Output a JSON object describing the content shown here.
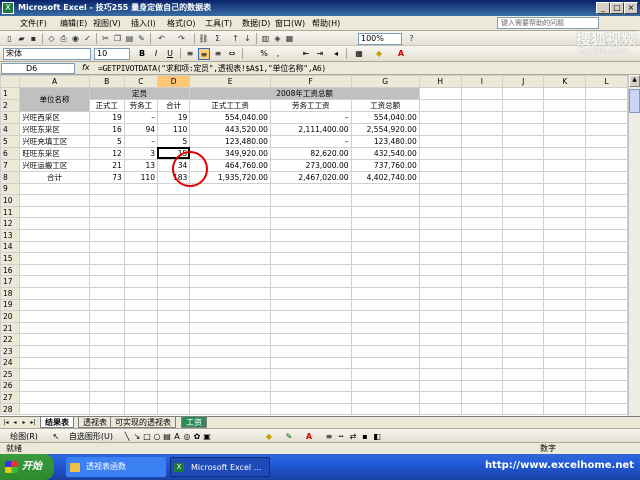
{
  "window": {
    "title": "Microsoft Excel - 技巧255 量身定做自己的数据表"
  },
  "menus": [
    "文件(F)",
    "编辑(E)",
    "视图(V)",
    "插入(I)",
    "格式(O)",
    "工具(T)",
    "数据(D)",
    "窗口(W)",
    "帮助(H)"
  ],
  "help_placeholder": "键入需要帮助的问题",
  "toolbar": {
    "zoom": "100%",
    "font": "宋体",
    "font_size": "10",
    "bold": "B",
    "italic": "I",
    "underline": "U",
    "percent": "%",
    "comma": ","
  },
  "formula_bar": {
    "cell_ref": "D6",
    "fx": "fx",
    "formula": "=GETPIVOTDATA(\"求和项:定员\",透视表!$A$1,\"单位名称\",A6)"
  },
  "watermark": {
    "line1": "搜狐视频",
    "line2": "tv.sohu.com"
  },
  "columns": [
    "A",
    "B",
    "C",
    "D",
    "E",
    "F",
    "G",
    "H",
    "I",
    "J",
    "K",
    "L"
  ],
  "rows": [
    "1",
    "2",
    "3",
    "4",
    "5",
    "6",
    "7",
    "8",
    "9",
    "10",
    "11",
    "12",
    "13",
    "14",
    "15",
    "16",
    "17",
    "18",
    "19",
    "20",
    "21",
    "22",
    "23",
    "24",
    "25",
    "26",
    "27",
    "28"
  ],
  "table": {
    "unit_name_header": "单位名称",
    "quota_header": "定员",
    "salary_header": "2008年工资总额",
    "sub_headers": [
      "正式工",
      "劳务工",
      "合计",
      "正式工工资",
      "劳务工工资",
      "工资总额"
    ],
    "rows": [
      [
        "兴旺西采区",
        "19",
        "–",
        "19",
        "554,040.00",
        "–",
        "554,040.00"
      ],
      [
        "兴旺东采区",
        "16",
        "94",
        "110",
        "443,520.00",
        "2,111,400.00",
        "2,554,920.00"
      ],
      [
        "兴旺充填工区",
        "5",
        "–",
        "5",
        "123,480.00",
        "–",
        "123,480.00"
      ],
      [
        "旺旺东采区",
        "12",
        "3",
        "15",
        "349,920.00",
        "82,620.00",
        "432,540.00"
      ],
      [
        "兴旺运搬工区",
        "21",
        "13",
        "34",
        "464,760.00",
        "273,000.00",
        "737,760.00"
      ],
      [
        "合计",
        "73",
        "110",
        "183",
        "1,935,720.00",
        "2,467,020.00",
        "4,402,740.00"
      ]
    ]
  },
  "sheet_tabs": [
    "结果表",
    "透视表",
    "可实现的透视表",
    "工资"
  ],
  "drawbar": {
    "draw": "绘图(R)",
    "autoshape": "自选图形(U)"
  },
  "status": {
    "left": "就绪",
    "right": "数字"
  },
  "taskbar": {
    "start": "开始",
    "tasks": [
      "透视表函数",
      "Microsoft Excel ..."
    ],
    "url": "http://www.excelhome.net"
  }
}
